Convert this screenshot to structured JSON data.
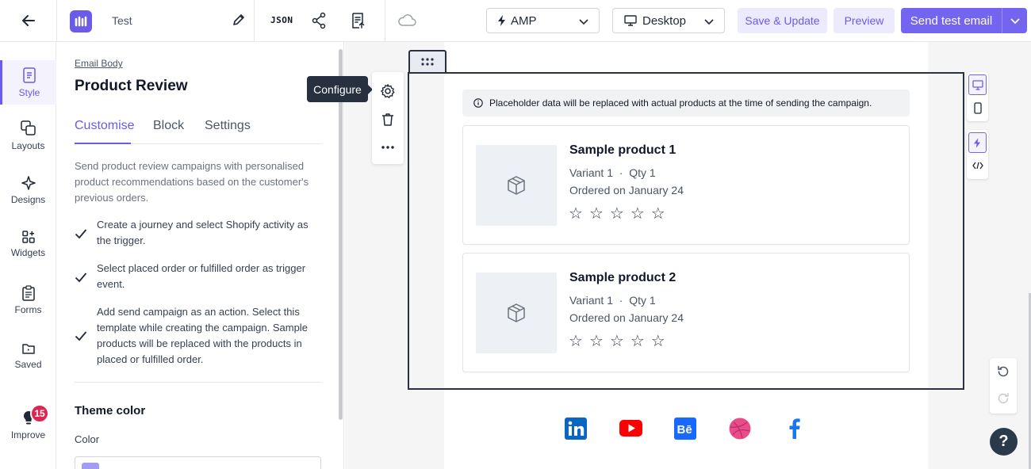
{
  "app": {
    "template_name": "Test",
    "json_label": "JSON",
    "mode_select": "AMP",
    "device_select": "Desktop",
    "save_update_label": "Save & Update",
    "preview_label": "Preview",
    "send_test_label": "Send test email",
    "accent": "#7465f0"
  },
  "rail": {
    "items": [
      {
        "label": "Style",
        "icon": "style-icon"
      },
      {
        "label": "Layouts",
        "icon": "layouts-icon"
      },
      {
        "label": "Designs",
        "icon": "sparkle-icon"
      },
      {
        "label": "Widgets",
        "icon": "widgets-icon"
      },
      {
        "label": "Forms",
        "icon": "forms-icon"
      },
      {
        "label": "Saved",
        "icon": "saved-folder-icon"
      },
      {
        "label": "Improve",
        "icon": "lightbulb-icon"
      }
    ],
    "improve_badge": "15"
  },
  "panel": {
    "breadcrumb": "Email Body",
    "title": "Product Review",
    "tabs": [
      "Customise",
      "Block",
      "Settings"
    ],
    "description": "Send product review campaigns with personalised product recommendations based on the customer's previous orders.",
    "steps": [
      "Create a journey and select Shopify activity as the trigger.",
      "Select placed order or fulfilled order as trigger event.",
      "Add send campaign as an action. Select this template while creating the campaign. Sample products will be replaced with the products in placed or fulfilled order."
    ],
    "theme_color_title": "Theme color",
    "color_label": "Color"
  },
  "toolbar": {
    "configure_tooltip": "Configure"
  },
  "canvas": {
    "notice": "Placeholder data will be replaced with actual products at the time of sending the campaign.",
    "products": [
      {
        "name": "Sample product 1",
        "variant": "Variant 1",
        "qty": "Qty 1",
        "ordered": "Ordered on January 24",
        "stars": 5
      },
      {
        "name": "Sample product 2",
        "variant": "Variant 1",
        "qty": "Qty 1",
        "ordered": "Ordered on January 24",
        "stars": 5
      }
    ],
    "social": [
      "linkedin-icon",
      "youtube-icon",
      "behance-icon",
      "dribbble-icon",
      "facebook-icon"
    ]
  },
  "help_label": "?"
}
